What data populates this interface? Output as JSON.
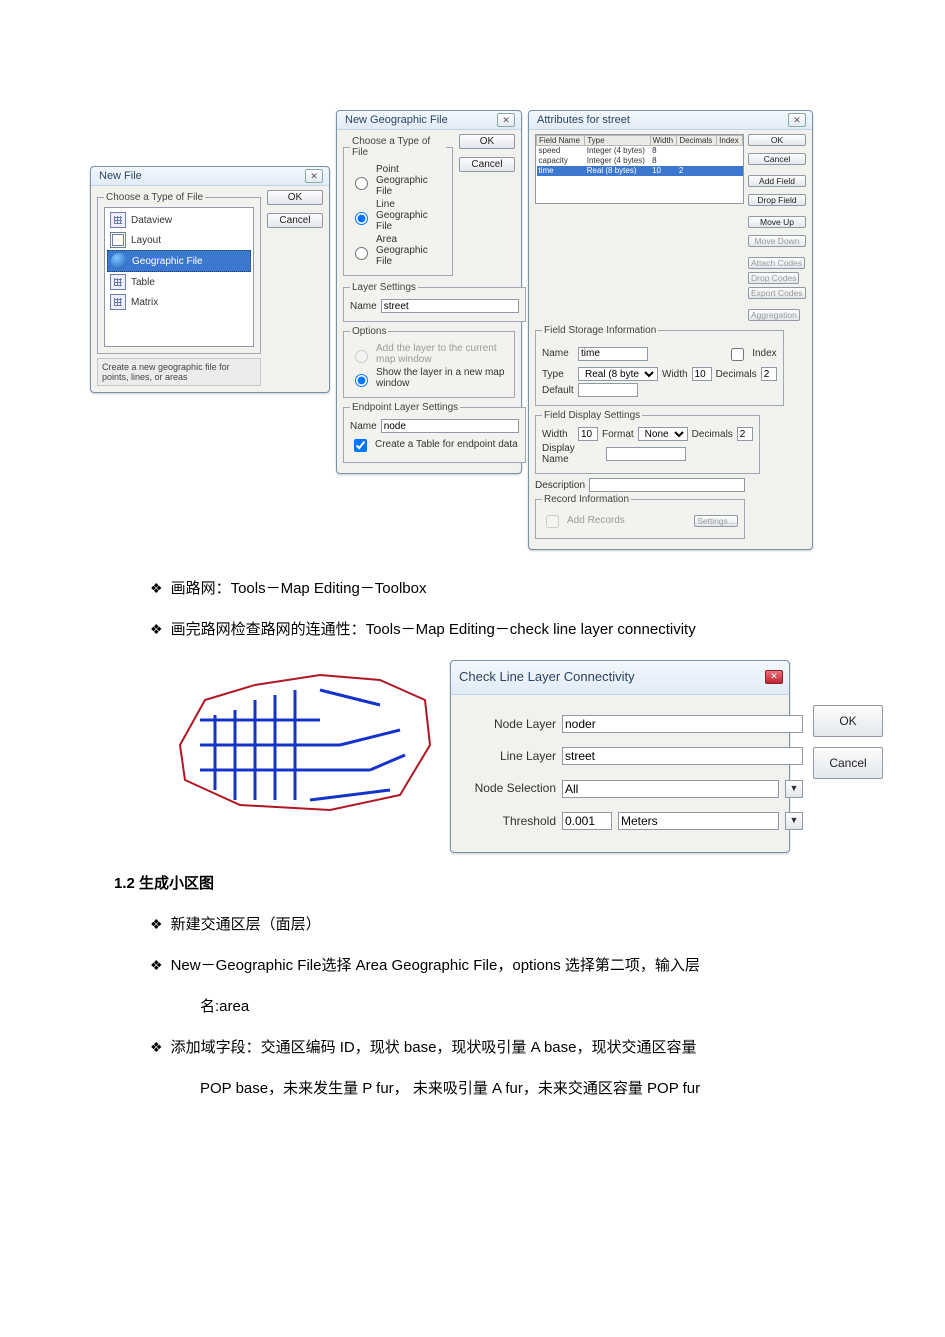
{
  "dialog_new_file": {
    "title": "New File",
    "group_label": "Choose a Type of File",
    "items": [
      "Dataview",
      "Layout",
      "Geographic File",
      "Table",
      "Matrix"
    ],
    "selected_index": 2,
    "ok": "OK",
    "cancel": "Cancel",
    "hint": "Create a new geographic file for points, lines, or areas"
  },
  "dialog_new_geo": {
    "title": "New Geographic File",
    "group_type": "Choose a Type of File",
    "opt_point": "Point Geographic File",
    "opt_line": "Line Geographic File",
    "opt_area": "Area Geographic File",
    "selected": "line",
    "ok": "OK",
    "cancel": "Cancel",
    "group_layer": "Layer Settings",
    "layer_name_label": "Name",
    "layer_name_value": "street",
    "group_options": "Options",
    "opt_add_current": "Add the layer to the current map window",
    "opt_show_new": "Show the layer in a new map window",
    "options_selected": "show_new",
    "group_endpoint": "Endpoint Layer Settings",
    "endpoint_name_label": "Name",
    "endpoint_name_value": "node",
    "endpoint_checkbox": "Create a Table for endpoint data",
    "endpoint_checked": true
  },
  "dialog_attrs": {
    "title": "Attributes for street",
    "cols": [
      "Field Name",
      "Type",
      "Width",
      "Decimals",
      "Index"
    ],
    "rows": [
      {
        "name": "speed",
        "type": "Integer (4 bytes)",
        "width": "8",
        "decimals": "",
        "selected": false
      },
      {
        "name": "capacity",
        "type": "Integer (4 bytes)",
        "width": "8",
        "decimals": "",
        "selected": false
      },
      {
        "name": "time",
        "type": "Real (8 bytes)",
        "width": "10",
        "decimals": "2",
        "selected": true
      }
    ],
    "ok": "OK",
    "cancel": "Cancel",
    "add_field": "Add Field",
    "drop_field": "Drop Field",
    "move_up": "Move Up",
    "move_down": "Move Down",
    "attach_codes": "Attach Codes",
    "drop_codes": "Drop Codes",
    "export_codes": "Export Codes",
    "aggregation": "Aggregation",
    "group_storage": "Field Storage Information",
    "storage_name_label": "Name",
    "storage_name_value": "time",
    "storage_type_label": "Type",
    "storage_type_value": "Real (8 bytes)",
    "storage_width_label": "Width",
    "storage_width_value": "10",
    "storage_decimals_label": "Decimals",
    "storage_decimals_value": "2",
    "storage_default_label": "Default",
    "storage_default_value": "",
    "storage_index_label": "Index",
    "storage_index_checked": false,
    "group_display": "Field Display Settings",
    "display_width_label": "Width",
    "display_width_value": "10",
    "display_format_label": "Format",
    "display_format_value": "None",
    "display_decimals_label": "Decimals",
    "display_decimals_value": "2",
    "display_name_label": "Display Name",
    "display_name_value": "",
    "description_label": "Description",
    "description_value": "",
    "group_record": "Record Information",
    "record_checkbox": "Add Records",
    "settings_btn": "Settings..."
  },
  "text": {
    "bullet1": "画路网：Tools－Map Editing－Toolbox",
    "bullet2": "画完路网检查路网的连通性：Tools－Map Editing－check line layer connectivity",
    "heading": "1.2 生成小区图",
    "b3": "新建交通区层（面层）",
    "b4": "New－Geographic File选择 Area Geographic File，options 选择第二项，输入层",
    "b4b": "名:area",
    "b5": "添加域字段：交通区编码 ID，现状 base，现状吸引量 A  base，现状交通区容量",
    "b5b": "POP base，未来发生量 P fur，  未来吸引量 A fur，未来交通区容量 POP fur"
  },
  "dialog_check": {
    "title": "Check Line Layer Connectivity",
    "node_layer_label": "Node Layer",
    "node_layer_value": "noder",
    "line_layer_label": "Line Layer",
    "line_layer_value": "street",
    "node_selection_label": "Node Selection",
    "node_selection_value": "All",
    "threshold_label": "Threshold",
    "threshold_value": "0.001",
    "threshold_unit": "Meters",
    "ok": "OK",
    "cancel": "Cancel"
  }
}
